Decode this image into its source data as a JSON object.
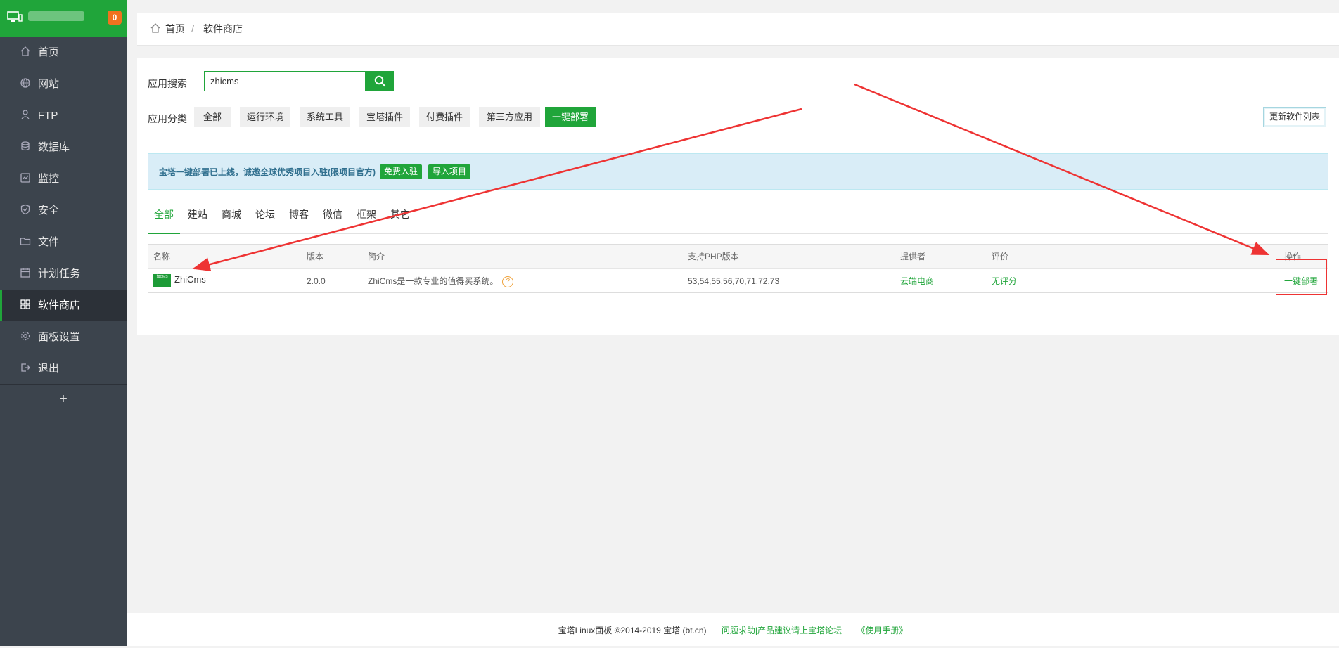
{
  "sidebar": {
    "badge": "0",
    "items": [
      {
        "label": "首页",
        "icon": "home-icon"
      },
      {
        "label": "网站",
        "icon": "globe-icon"
      },
      {
        "label": "FTP",
        "icon": "ftp-icon"
      },
      {
        "label": "数据库",
        "icon": "database-icon"
      },
      {
        "label": "监控",
        "icon": "monitor-icon"
      },
      {
        "label": "安全",
        "icon": "shield-icon"
      },
      {
        "label": "文件",
        "icon": "folder-icon"
      },
      {
        "label": "计划任务",
        "icon": "calendar-icon"
      },
      {
        "label": "软件商店",
        "icon": "grid-icon"
      },
      {
        "label": "面板设置",
        "icon": "gear-icon"
      },
      {
        "label": "退出",
        "icon": "logout-icon"
      }
    ],
    "active_index": 8,
    "add": "+"
  },
  "breadcrumb": {
    "home": "首页",
    "separator": "/",
    "current": "软件商店"
  },
  "search": {
    "label": "应用搜索",
    "value": "zhicms"
  },
  "categories": {
    "label": "应用分类",
    "items": [
      "全部",
      "运行环境",
      "系统工具",
      "宝塔插件",
      "付费插件",
      "第三方应用",
      "一键部署"
    ],
    "active": "一键部署"
  },
  "update_button": "更新软件列表",
  "notice": {
    "text": "宝塔一键部署已上线，诚邀全球优秀项目入驻(限项目官方)",
    "btn_free": "免费入驻",
    "btn_import": "导入项目"
  },
  "tabs": {
    "items": [
      "全部",
      "建站",
      "商城",
      "论坛",
      "博客",
      "微信",
      "框架",
      "其它"
    ],
    "active": "全部"
  },
  "table": {
    "headers": [
      "名称",
      "版本",
      "简介",
      "支持PHP版本",
      "提供者",
      "评价",
      "操作"
    ],
    "rows": [
      {
        "name": "ZhiCms",
        "logo_text": "知CMS",
        "version": "2.0.0",
        "desc": "ZhiCms是一款专业的值得买系统。",
        "help": "?",
        "php": "53,54,55,56,70,71,72,73",
        "provider": "云端电商",
        "rating": "无评分",
        "action": "一键部署"
      }
    ]
  },
  "footer": {
    "copyright": "宝塔Linux面板 ©2014-2019 宝塔 (bt.cn)",
    "forum": "问题求助|产品建议请上宝塔论坛",
    "manual": "《使用手册》"
  },
  "colors": {
    "accent": "#20a53a",
    "sidebar": "#3c444d",
    "annotation": "#e33333"
  }
}
